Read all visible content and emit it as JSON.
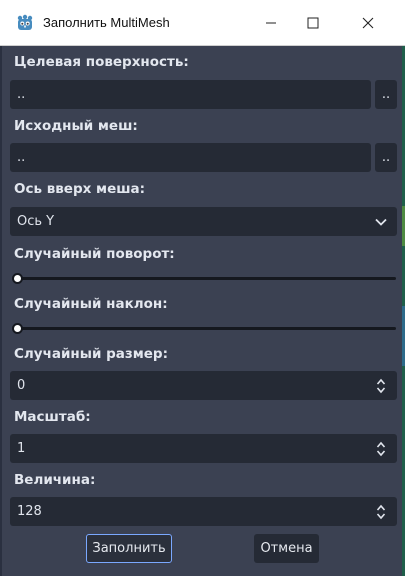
{
  "window": {
    "title": "Заполнить MultiMesh"
  },
  "fields": {
    "target_surface": {
      "label": "Целевая поверхность:",
      "value": "..",
      "browse": ".."
    },
    "source_mesh": {
      "label": "Исходный меш:",
      "value": "..",
      "browse": ".."
    },
    "mesh_up_axis": {
      "label": "Ось вверх меша:",
      "value": "Ось Y"
    },
    "random_rotation": {
      "label": "Случайный поворот:",
      "value": 0
    },
    "random_tilt": {
      "label": "Случайный наклон:",
      "value": 0
    },
    "random_scale": {
      "label": "Случайный размер:",
      "value": "0"
    },
    "scale": {
      "label": "Масштаб:",
      "value": "1"
    },
    "amount": {
      "label": "Величина:",
      "value": "128"
    }
  },
  "buttons": {
    "fill": "Заполнить",
    "cancel": "Отмена"
  },
  "colors": {
    "accent": "#7aa8ff",
    "panel": "#3b4152",
    "field": "#252a35"
  },
  "icons": {
    "app": "godot-icon",
    "minimize": "minimize-icon",
    "maximize": "maximize-icon",
    "close": "close-icon",
    "dropdown": "chevron-down-icon",
    "spinner": "spinner-arrows-icon"
  }
}
